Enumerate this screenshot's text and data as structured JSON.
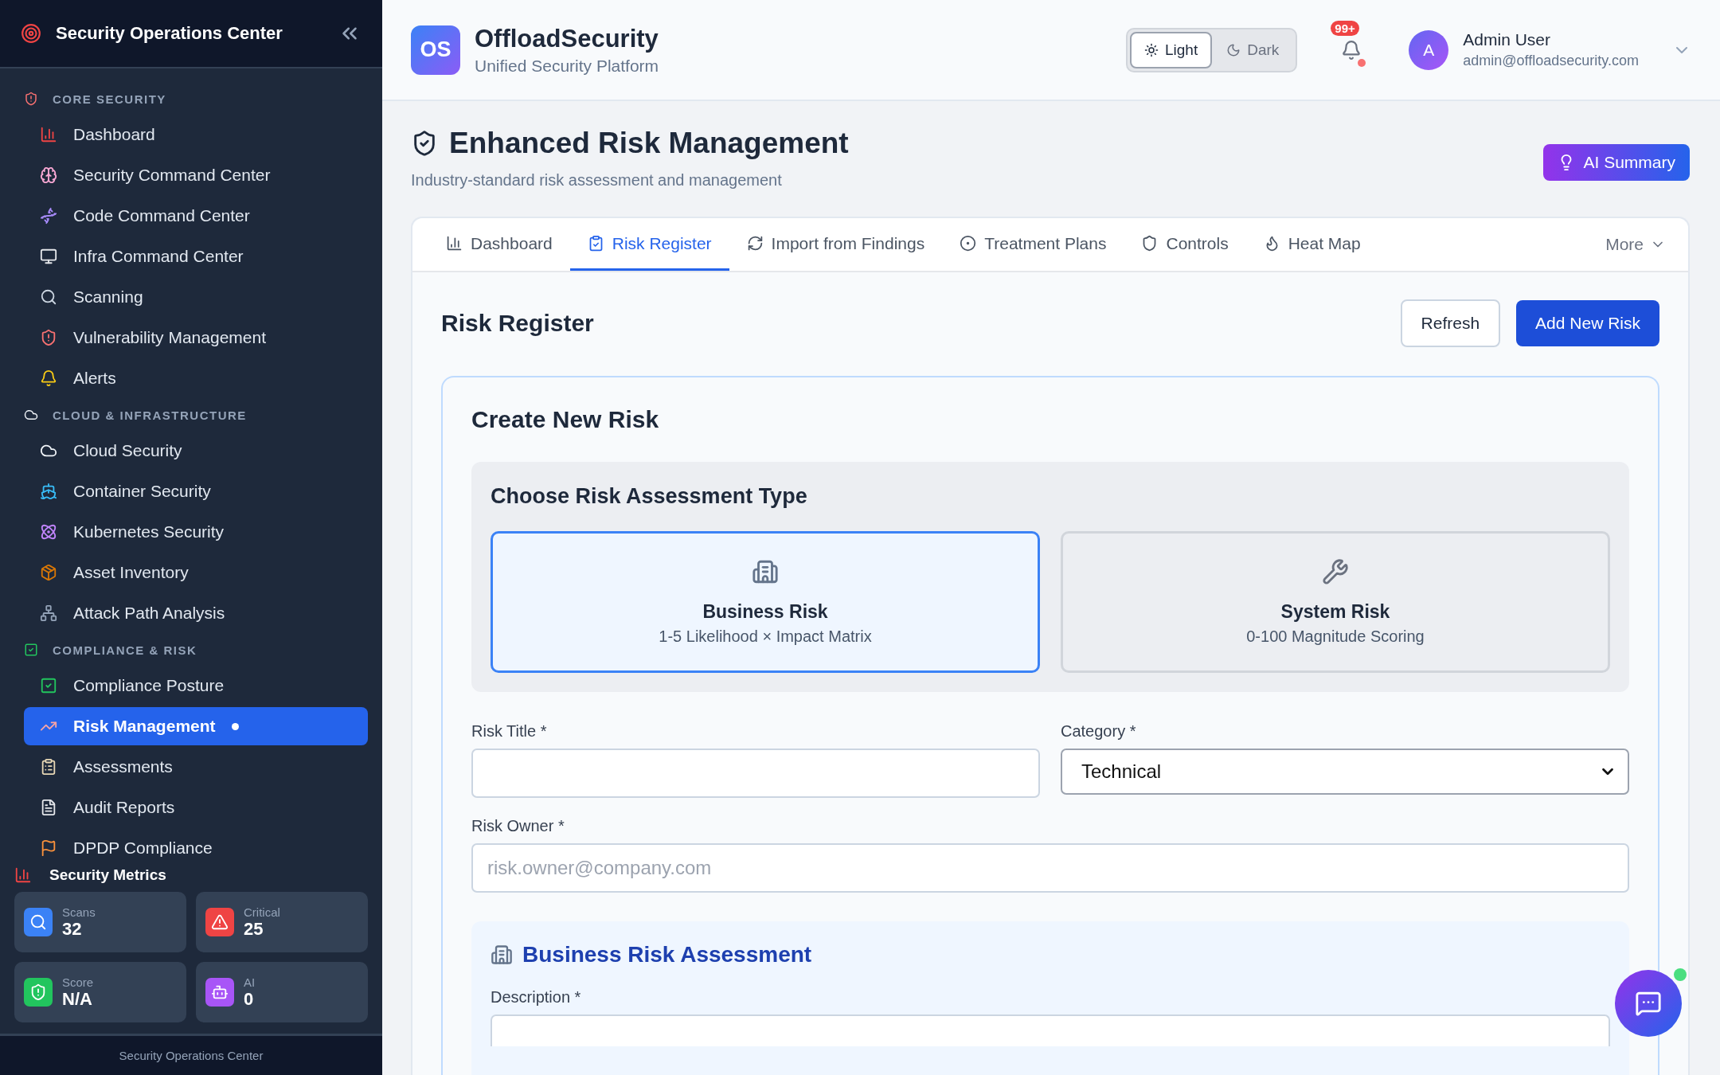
{
  "sidebar": {
    "title": "Security Operations Center",
    "sections": [
      {
        "label": "CORE SECURITY",
        "items": [
          {
            "label": "Dashboard",
            "selected": false
          },
          {
            "label": "Security Command Center",
            "selected": false
          },
          {
            "label": "Code Command Center",
            "selected": false
          },
          {
            "label": "Infra Command Center",
            "selected": false
          },
          {
            "label": "Scanning",
            "selected": false
          },
          {
            "label": "Vulnerability Management",
            "selected": false
          },
          {
            "label": "Alerts",
            "selected": false
          }
        ]
      },
      {
        "label": "CLOUD & INFRASTRUCTURE",
        "items": [
          {
            "label": "Cloud Security",
            "selected": false
          },
          {
            "label": "Container Security",
            "selected": false
          },
          {
            "label": "Kubernetes Security",
            "selected": false
          },
          {
            "label": "Asset Inventory",
            "selected": false
          },
          {
            "label": "Attack Path Analysis",
            "selected": false
          }
        ]
      },
      {
        "label": "COMPLIANCE & RISK",
        "items": [
          {
            "label": "Compliance Posture",
            "selected": false
          },
          {
            "label": "Risk Management",
            "selected": true
          },
          {
            "label": "Assessments",
            "selected": false
          },
          {
            "label": "Audit Reports",
            "selected": false
          },
          {
            "label": "DPDP Compliance",
            "selected": false
          }
        ]
      }
    ],
    "metrics": {
      "title": "Security Metrics",
      "cards": [
        {
          "label": "Scans",
          "value": "32",
          "color": "#3b82f6"
        },
        {
          "label": "Critical",
          "value": "25",
          "color": "#ef4444"
        },
        {
          "label": "Score",
          "value": "N/A",
          "color": "#22c55e"
        },
        {
          "label": "AI",
          "value": "0",
          "color": "#a855f7"
        }
      ]
    },
    "footer": "Security Operations Center"
  },
  "header": {
    "logo": "OS",
    "brand": "OffloadSecurity",
    "tagline": "Unified Security Platform",
    "theme": [
      {
        "label": "Light",
        "selected": true
      },
      {
        "label": "Dark",
        "selected": false
      }
    ],
    "notifications": "99+",
    "user": {
      "initial": "A",
      "name": "Admin User",
      "email": "admin@offloadsecurity.com"
    }
  },
  "page": {
    "title": "Enhanced Risk Management",
    "subtitle": "Industry-standard risk assessment and management",
    "ai_button": "AI Summary",
    "tabs": [
      {
        "label": "Dashboard",
        "selected": false
      },
      {
        "label": "Risk Register",
        "selected": true
      },
      {
        "label": "Import from Findings",
        "selected": false
      },
      {
        "label": "Treatment Plans",
        "selected": false
      },
      {
        "label": "Controls",
        "selected": false
      },
      {
        "label": "Heat Map",
        "selected": false
      }
    ],
    "more": "More",
    "section_title": "Risk Register",
    "buttons": {
      "refresh": "Refresh",
      "add": "Add New Risk"
    },
    "form": {
      "title": "Create New Risk",
      "type_title": "Choose Risk Assessment Type",
      "types": [
        {
          "title": "Business Risk",
          "desc": "1-5 Likelihood × Impact Matrix",
          "selected": true
        },
        {
          "title": "System Risk",
          "desc": "0-100 Magnitude Scoring",
          "selected": false
        }
      ],
      "risk_title": {
        "label": "Risk Title *"
      },
      "category": {
        "label": "Category *",
        "value": "Technical"
      },
      "owner": {
        "label": "Risk Owner *",
        "placeholder": "risk.owner@company.com"
      },
      "assessment": {
        "title": "Business Risk Assessment",
        "description_label": "Description *"
      }
    }
  }
}
